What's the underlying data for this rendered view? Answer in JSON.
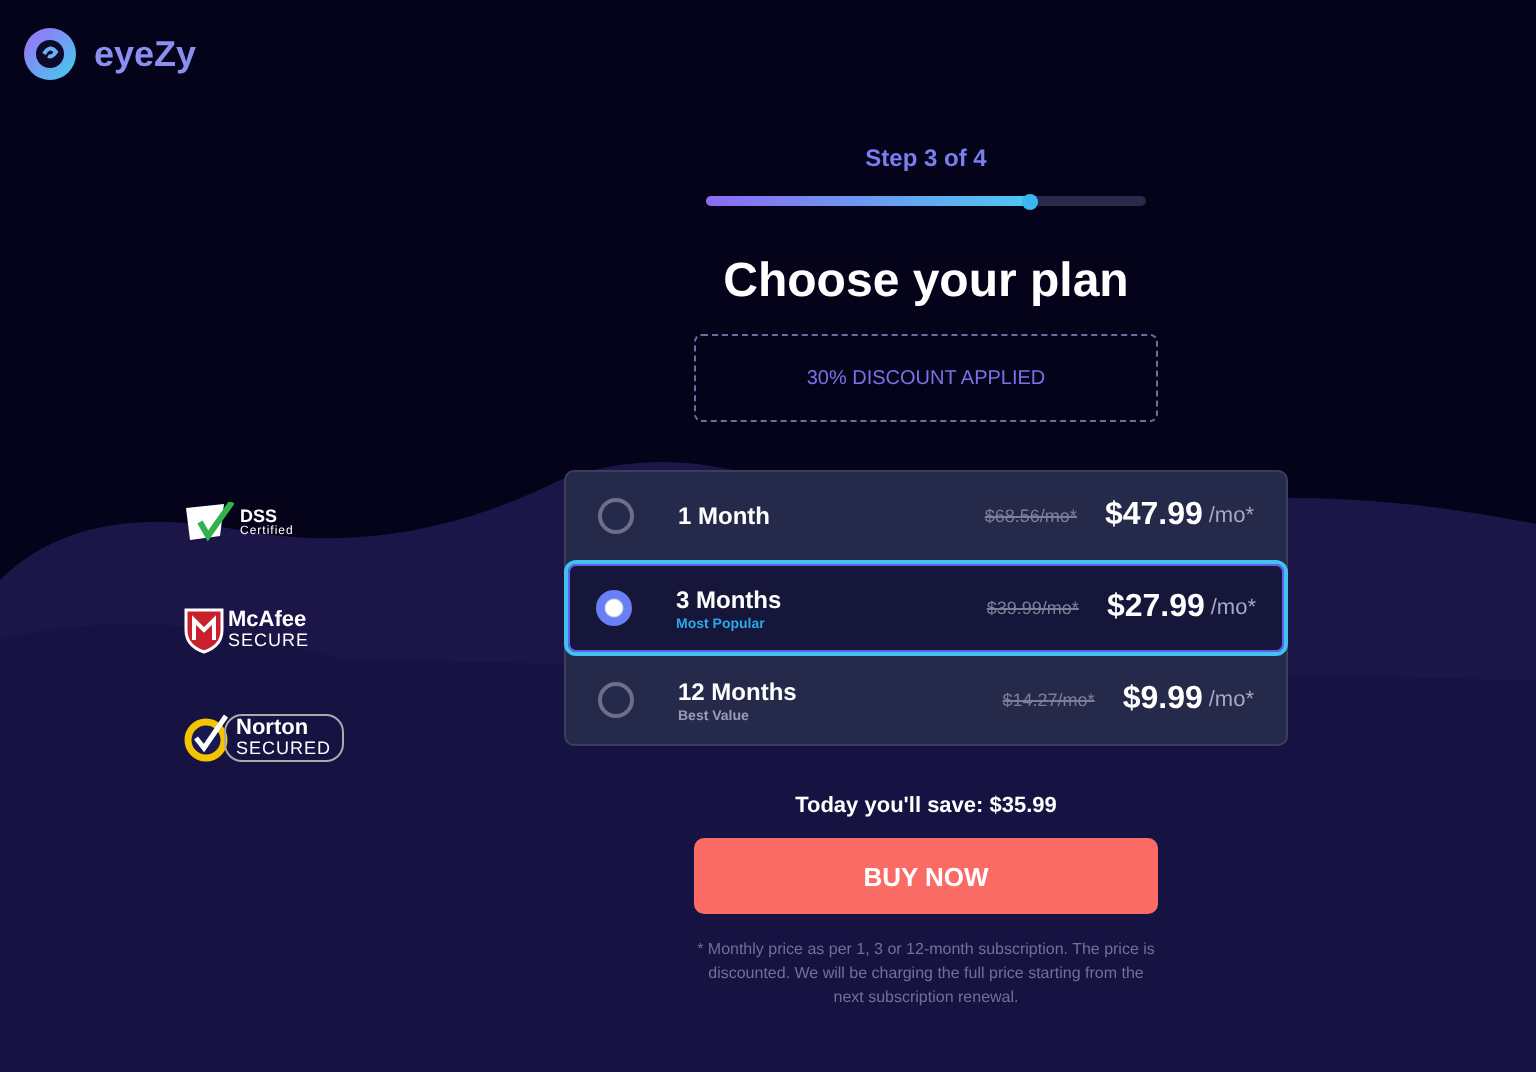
{
  "brand": {
    "name": "eyeZy"
  },
  "progress": {
    "label": "Step 3 of 4",
    "level": 0.74
  },
  "title": "Choose your plan",
  "discount": "30% DISCOUNT APPLIED",
  "badges": [
    {
      "kind": "pci",
      "line1": "DSS",
      "line2": "Certified"
    },
    {
      "kind": "mcafee",
      "line1": "McAfee",
      "line2": "SECURE"
    },
    {
      "kind": "norton",
      "line1": "Norton",
      "line2": "SECURED"
    }
  ],
  "plans": [
    {
      "name": "1 Month",
      "old_price": "$68.56/mo*",
      "price": "$47.99",
      "unit": "/mo*",
      "selected": false
    },
    {
      "name": "3 Months",
      "note": "Most Popular",
      "old_price": "$39.99/mo*",
      "price": "$27.99",
      "unit": "/mo*",
      "selected": true
    },
    {
      "name": "12 Months",
      "note": "Best Value",
      "old_price": "$14.27/mo*",
      "price": "$9.99",
      "unit": "/mo*",
      "selected": false
    }
  ],
  "savings": "Today you'll save: $35.99",
  "buy_button": "BUY NOW",
  "footnote": "* Monthly price as per 1, 3 or 12-month subscription. The price is discounted. We will be charging the full price starting from the next subscription renewal."
}
